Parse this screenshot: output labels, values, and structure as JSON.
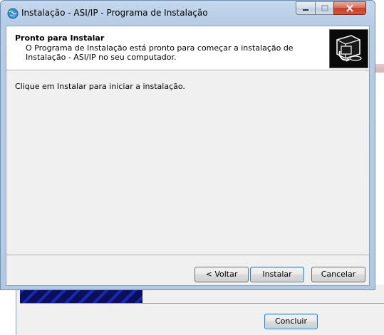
{
  "window": {
    "title": "Instalação - ASI/IP - Programa de Instalação"
  },
  "header": {
    "title": "Pronto para Instalar",
    "subtitle": "O Programa de Instalação está pronto para começar a instalação de Instalação - ASI/IP no seu computador."
  },
  "body": {
    "text": "Clique em Instalar para iniciar a instalação."
  },
  "buttons": {
    "back": "< Voltar",
    "install": "Instalar",
    "cancel": "Cancelar"
  },
  "background_window": {
    "finish_button": "Concluir"
  },
  "icons": {
    "app": "globe-icon",
    "header": "computer-install-icon"
  },
  "colors": {
    "titlebar": "#b7cde6",
    "close_button": "#c5402a",
    "header_bg": "#ffffff",
    "client_bg": "#f0f0f0",
    "default_button_border": "#3c7fb1",
    "banner": "#0b0f5e"
  }
}
